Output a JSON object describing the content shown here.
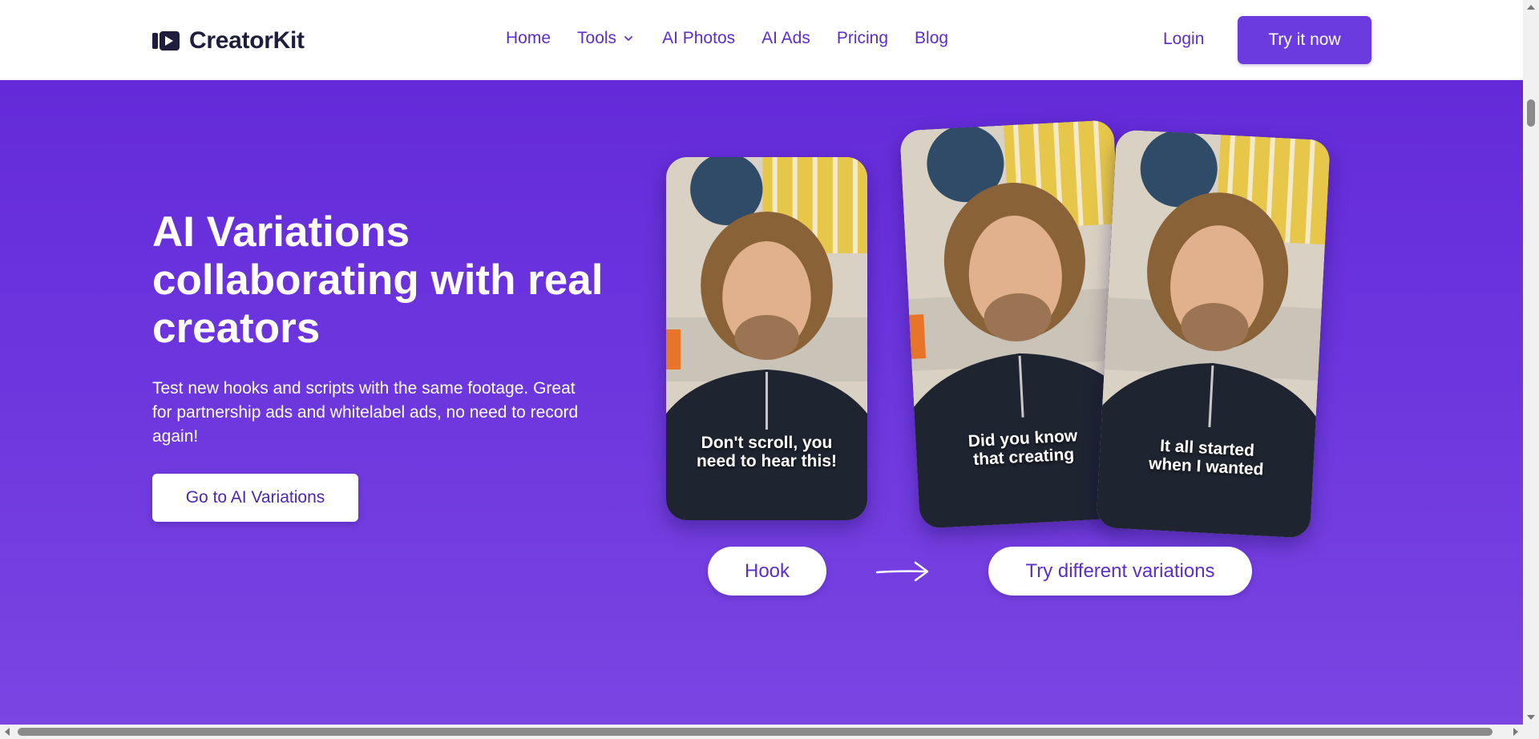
{
  "brand": {
    "name": "CreatorKit",
    "logo_icon": "play-video-logo-icon"
  },
  "nav": {
    "items": [
      {
        "label": "Home"
      },
      {
        "label": "Tools",
        "icon": "chevron-down-icon"
      },
      {
        "label": "AI Photos"
      },
      {
        "label": "AI Ads"
      },
      {
        "label": "Pricing"
      },
      {
        "label": "Blog"
      }
    ],
    "login_label": "Login",
    "cta_label": "Try it now"
  },
  "hero": {
    "title_lines": [
      "AI Variations",
      "collaborating with real",
      "creators"
    ],
    "description_lines": [
      "Test new hooks and scripts with the same footage. Great",
      "for partnership ads and whitelabel ads, no need to record",
      "again!"
    ],
    "cta_label": "Go to AI Variations"
  },
  "cards": [
    {
      "caption_lines": [
        "Don't scroll, you",
        "need to hear this!"
      ]
    },
    {
      "caption_lines": [
        "Did you know",
        "that creating"
      ]
    },
    {
      "caption_lines": [
        "It all started",
        "when I wanted"
      ]
    }
  ],
  "pills": {
    "hook_label": "Hook",
    "variations_label": "Try different variations",
    "arrow_icon": "arrow-right-icon"
  },
  "colors": {
    "brand_purple": "#6b3be0",
    "hero_bg": "#642ad9",
    "nav_text": "#5b2fc9",
    "logo_text": "#1f1d3d"
  }
}
